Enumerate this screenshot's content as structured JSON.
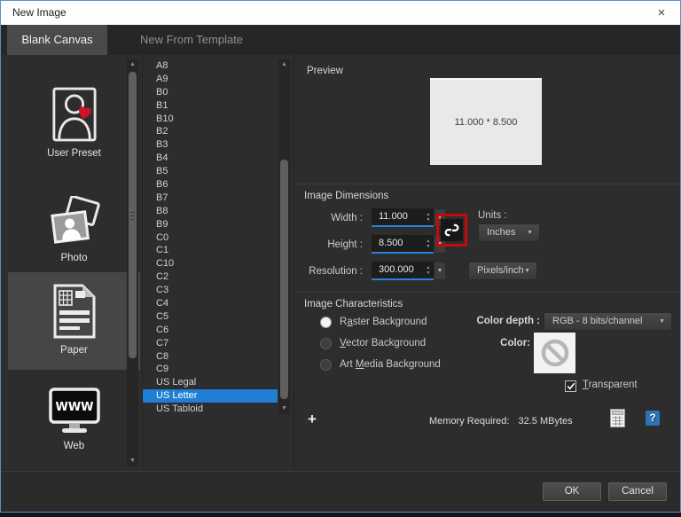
{
  "window": {
    "title": "New Image",
    "close_icon": "×"
  },
  "tabs": [
    {
      "label": "Blank Canvas",
      "selected": true
    },
    {
      "label": "New From Template",
      "selected": false
    }
  ],
  "categories": [
    {
      "label": "User Preset",
      "icon": "user-preset-icon",
      "selected": false
    },
    {
      "label": "Photo",
      "icon": "photo-icon",
      "selected": false
    },
    {
      "label": "Paper",
      "icon": "paper-icon",
      "selected": true
    },
    {
      "label": "Web",
      "icon": "web-icon",
      "selected": false
    }
  ],
  "size_list": {
    "items": [
      "A8",
      "A9",
      "B0",
      "B1",
      "B10",
      "B2",
      "B3",
      "B4",
      "B5",
      "B6",
      "B7",
      "B8",
      "B9",
      "C0",
      "C1",
      "C10",
      "C2",
      "C3",
      "C4",
      "C5",
      "C6",
      "C7",
      "C8",
      "C9",
      "US Legal",
      "US Letter",
      "US Tabloid"
    ],
    "selected_item": "US Letter",
    "selection_color": "#1e7fd4"
  },
  "preview": {
    "heading": "Preview",
    "canvas_text": "11.000 * 8.500"
  },
  "image_dimensions": {
    "heading": "Image Dimensions",
    "width": {
      "label": "Width :",
      "value": "11.000"
    },
    "height": {
      "label": "Height :",
      "value": "8.500"
    },
    "resolution": {
      "label": "Resolution :",
      "value": "300.000"
    },
    "units": {
      "label": "Units :",
      "value": "Inches"
    },
    "resolution_units": {
      "value": "Pixels/inch"
    },
    "link_icon": "link-dimensions-icon",
    "annotation_color": "#c9080a",
    "accent_color": "#2a82da",
    "spin_up": "▲",
    "spin_down": "▼",
    "dropdown_caret": "▼"
  },
  "image_characteristics": {
    "heading": "Image Characteristics",
    "background_options": [
      {
        "pre": "R",
        "key": "a",
        "post": "ster Background",
        "selected": true
      },
      {
        "pre": "",
        "key": "V",
        "post": "ector Background",
        "selected": false
      },
      {
        "pre": "Art ",
        "key": "M",
        "post": "edia Background",
        "selected": false
      }
    ],
    "color_depth": {
      "label": "Color depth :",
      "value": "RGB - 8 bits/channel"
    },
    "color": {
      "label": "Color:",
      "swatch_icon": "no-color-transparent-icon"
    },
    "transparent": {
      "pre": "",
      "key": "T",
      "post": "ransparent",
      "checked": true
    }
  },
  "memory": {
    "label": "Memory Required:",
    "value": "32.5 MBytes"
  },
  "footer": {
    "ok_label": "OK",
    "cancel_label": "Cancel"
  },
  "misc_icons": {
    "add": "plus-icon",
    "calculator": "calculator-icon",
    "help": "help-icon"
  }
}
